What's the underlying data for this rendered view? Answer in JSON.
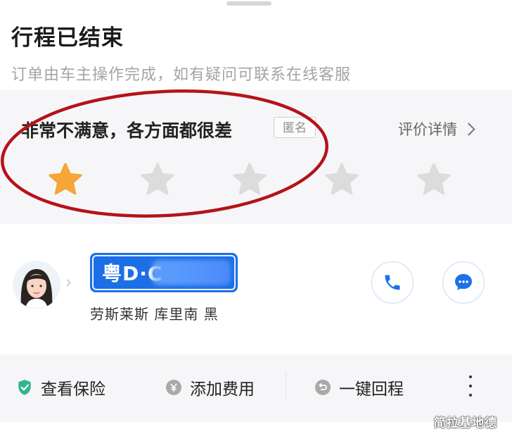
{
  "header": {
    "title": "行程已结束",
    "subtitle": "订单由车主操作完成，如有疑问可联系在线客服"
  },
  "rating": {
    "text": "非常不满意，各方面都很差",
    "anonymous_tag": "匿名",
    "detail_link": "评价详情",
    "stars_total": 5,
    "stars_selected": 1,
    "star_active_color": "#f5a637",
    "star_inactive_color": "#dcdcdc",
    "annotation_color": "#b5131a"
  },
  "driver": {
    "plate_prefix": "粤D·C",
    "plate_color": "#1c6fe6",
    "car_info": "劳斯莱斯 库里南 黑",
    "call_icon": "phone-icon",
    "chat_icon": "chat-bubble-icon"
  },
  "actions": {
    "insurance_label": "查看保险",
    "insurance_icon": "shield-check-icon",
    "fee_label": "添加费用",
    "fee_icon": "yen-coin-icon",
    "return_label": "一键回程",
    "return_icon": "return-arrow-icon",
    "more_icon": "more-vertical-icon"
  },
  "watermark": "简拉基地德"
}
